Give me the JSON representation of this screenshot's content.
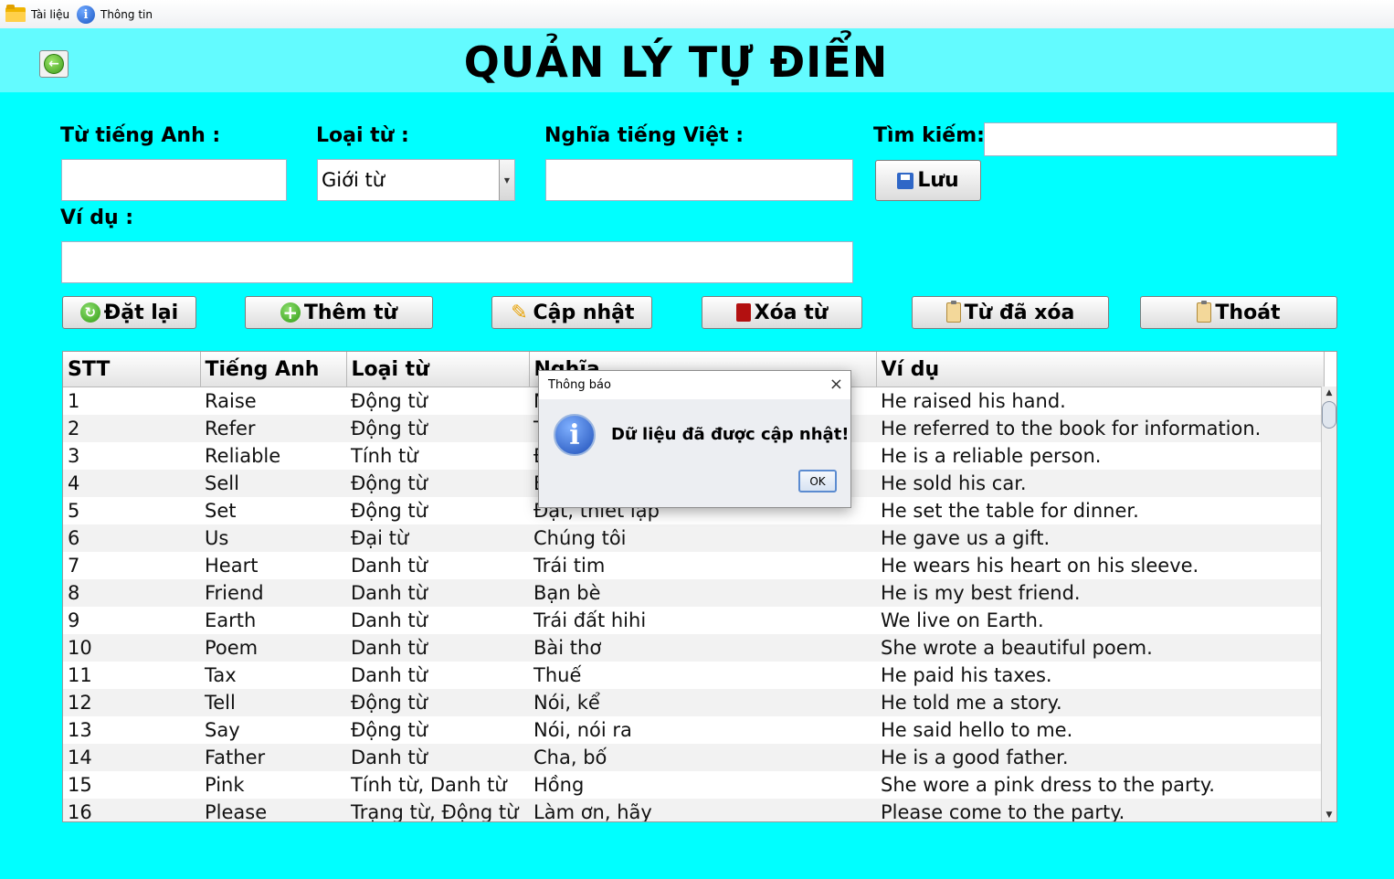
{
  "menu": {
    "items": [
      {
        "label": "Tài liệu",
        "icon": "folder-icon"
      },
      {
        "label": "Thông tin",
        "icon": "info-icon"
      }
    ]
  },
  "header": {
    "title": "QUẢN LÝ TỰ ĐIỂN"
  },
  "form": {
    "english_label": "Từ tiếng Anh :",
    "english_value": "",
    "type_label": "Loại từ :",
    "type_value": "Giới từ",
    "meaning_label": "Nghĩa tiếng Việt :",
    "meaning_value": "",
    "search_label": "Tìm kiếm:",
    "search_value": "",
    "example_label": "Ví dụ :",
    "example_value": "",
    "save_label": "Lưu"
  },
  "actions": {
    "reset": "Đặt lại",
    "add": "Thêm từ",
    "update": "Cập nhật",
    "delete": "Xóa từ",
    "deleted_words": "Từ đã xóa",
    "exit": "Thoát"
  },
  "table": {
    "columns": [
      "STT",
      "Tiếng Anh",
      "Loại từ",
      "Nghĩa",
      "Ví dụ"
    ],
    "rows": [
      [
        "1",
        "Raise",
        "Động từ",
        "N",
        "He raised his hand."
      ],
      [
        "2",
        "Refer",
        "Động từ",
        "T",
        "He referred to the book for information."
      ],
      [
        "3",
        "Reliable",
        "Tính từ",
        "Đ",
        "He is a reliable person."
      ],
      [
        "4",
        "Sell",
        "Động từ",
        "B",
        "He sold his car."
      ],
      [
        "5",
        "Set",
        "Động từ",
        "Đặt, thiết lập",
        "He set the table for dinner."
      ],
      [
        "6",
        "Us",
        "Đại từ",
        "Chúng tôi",
        "He gave us a gift."
      ],
      [
        "7",
        "Heart",
        "Danh từ",
        "Trái tim",
        "He wears his heart on his sleeve."
      ],
      [
        "8",
        "Friend",
        "Danh từ",
        "Bạn bè",
        "He is my best friend."
      ],
      [
        "9",
        "Earth",
        "Danh từ",
        "Trái đất hihi",
        "We live on Earth."
      ],
      [
        "10",
        "Poem",
        "Danh từ",
        "Bài thơ",
        "She wrote a beautiful poem."
      ],
      [
        "11",
        "Tax",
        "Danh từ",
        "Thuế",
        "He paid his taxes."
      ],
      [
        "12",
        "Tell",
        "Động từ",
        "Nói, kể",
        "He told me a story."
      ],
      [
        "13",
        "Say",
        "Động từ",
        "Nói, nói ra",
        "He said hello to me."
      ],
      [
        "14",
        "Father",
        "Danh từ",
        "Cha, bố",
        "He is a good father."
      ],
      [
        "15",
        "Pink",
        "Tính từ, Danh từ",
        "Hồng",
        "She wore a pink dress to the party."
      ],
      [
        "16",
        "Please",
        "Trạng từ, Động từ",
        "Làm ơn, hãy",
        "Please come to the party."
      ]
    ]
  },
  "dialog": {
    "title": "Thông báo",
    "message": "Dữ liệu đã được cập nhật!",
    "ok_label": "OK",
    "close_glyph": "×"
  },
  "colors": {
    "background": "#00ffff",
    "header": "#63fbff"
  }
}
